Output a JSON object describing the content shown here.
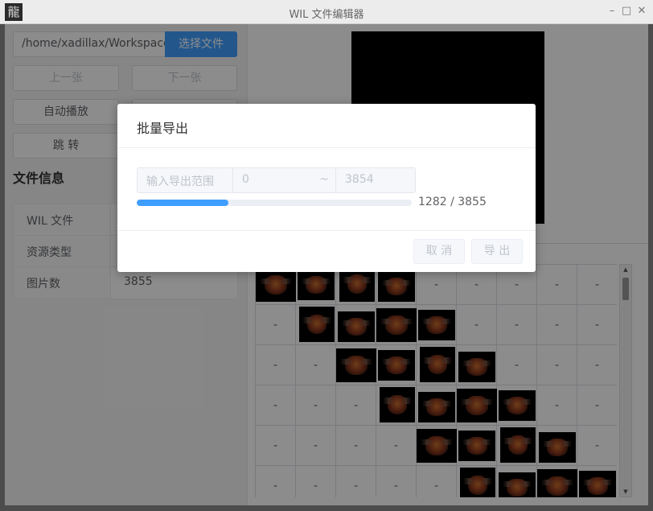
{
  "window": {
    "title": "WIL 文件编辑器",
    "icon_glyph": "龍",
    "controls": [
      "–",
      "□",
      "✕"
    ]
  },
  "toolbar": {
    "path_value": "/home/xadillax/Workspace/",
    "choose_file": "选择文件",
    "prev": "上一张",
    "next": "下一张",
    "autoplay": "自动播放",
    "jump": "跳 转"
  },
  "file_info": {
    "title": "文件信息",
    "rows": [
      {
        "key": "WIL 文件",
        "value": ""
      },
      {
        "key": "资源类型",
        "value": ""
      },
      {
        "key": "图片数",
        "value": "3855"
      }
    ]
  },
  "grid": {
    "placeholder": "-",
    "rows": [
      [
        1,
        1,
        1,
        1,
        0,
        0,
        0,
        0,
        0
      ],
      [
        0,
        1,
        1,
        1,
        1,
        0,
        0,
        0,
        0
      ],
      [
        0,
        0,
        1,
        1,
        1,
        1,
        0,
        0,
        0
      ],
      [
        0,
        0,
        0,
        1,
        1,
        1,
        1,
        0,
        0
      ],
      [
        0,
        0,
        0,
        0,
        1,
        1,
        1,
        1,
        0
      ],
      [
        0,
        0,
        0,
        0,
        0,
        1,
        1,
        1,
        1
      ]
    ]
  },
  "dialog": {
    "title": "批量导出",
    "range_label": "输入导出范围",
    "range_from": "0",
    "range_sep": "~",
    "range_to": "3854",
    "progress_fraction": 0.3326,
    "progress_text": "1282 / 3855",
    "cancel": "取 消",
    "export": "导 出"
  },
  "colors": {
    "accent": "#409eff"
  }
}
